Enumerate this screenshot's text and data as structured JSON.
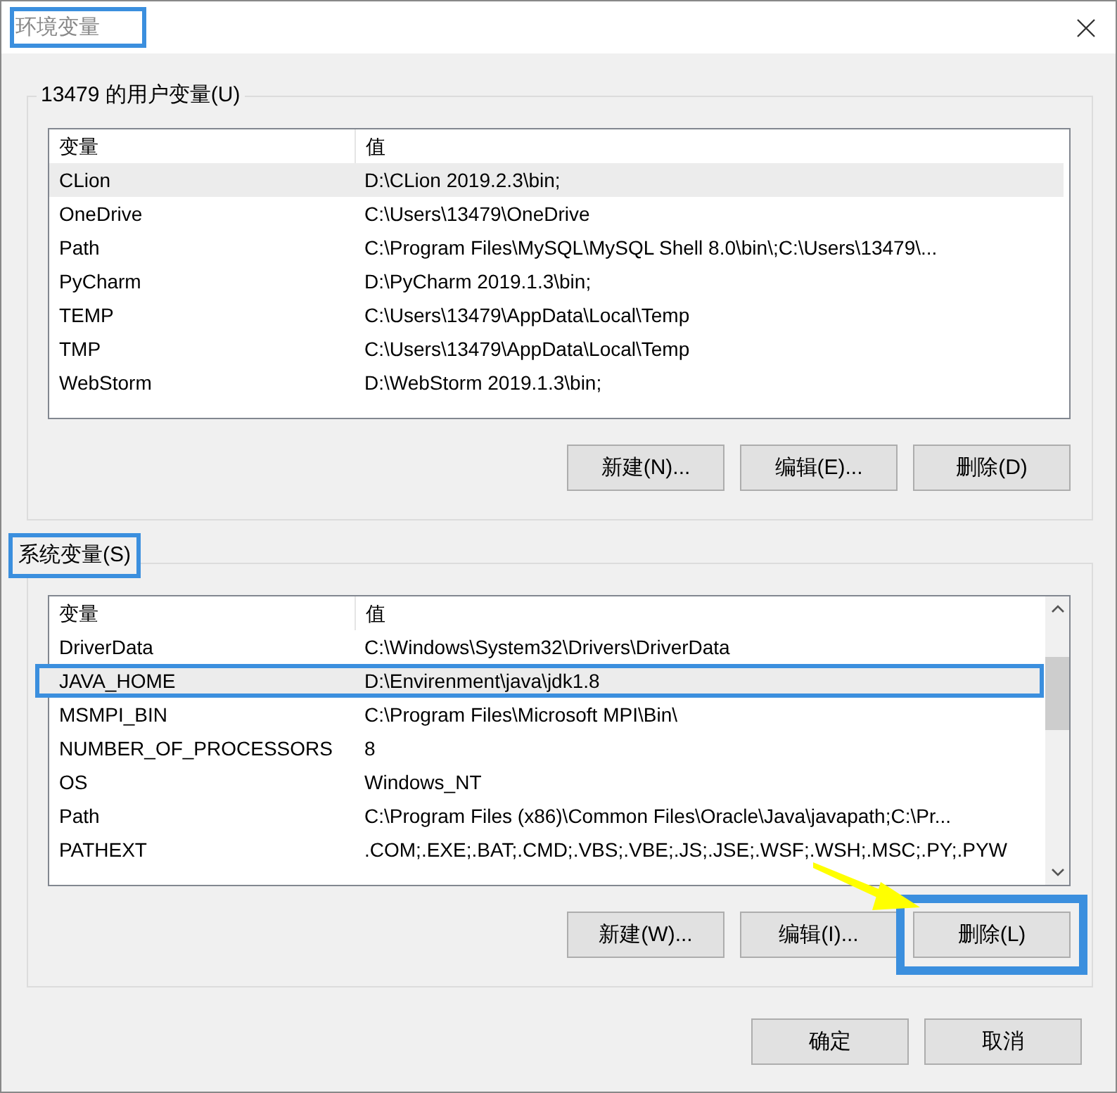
{
  "window": {
    "title": "环境变量",
    "title_highlighted": true
  },
  "user_variables": {
    "label": "13479 的用户变量(U)",
    "columns": [
      "变量",
      "值"
    ],
    "rows": [
      {
        "name": "CLion",
        "value": "D:\\CLion 2019.2.3\\bin;",
        "selected": true,
        "highlighted": false
      },
      {
        "name": "OneDrive",
        "value": "C:\\Users\\13479\\OneDrive",
        "selected": false,
        "highlighted": false
      },
      {
        "name": "Path",
        "value": "C:\\Program Files\\MySQL\\MySQL Shell 8.0\\bin\\;C:\\Users\\13479\\...",
        "selected": false,
        "highlighted": false
      },
      {
        "name": "PyCharm",
        "value": "D:\\PyCharm 2019.1.3\\bin;",
        "selected": false,
        "highlighted": false
      },
      {
        "name": "TEMP",
        "value": "C:\\Users\\13479\\AppData\\Local\\Temp",
        "selected": false,
        "highlighted": false
      },
      {
        "name": "TMP",
        "value": "C:\\Users\\13479\\AppData\\Local\\Temp",
        "selected": false,
        "highlighted": false
      },
      {
        "name": "WebStorm",
        "value": "D:\\WebStorm 2019.1.3\\bin;",
        "selected": false,
        "highlighted": false
      }
    ],
    "buttons": [
      {
        "label": "新建(N)...",
        "highlighted": false
      },
      {
        "label": "编辑(E)...",
        "highlighted": false
      },
      {
        "label": "删除(D)",
        "highlighted": false
      }
    ]
  },
  "system_variables": {
    "label": "系统变量(S)",
    "label_highlighted": true,
    "columns": [
      "变量",
      "值"
    ],
    "rows": [
      {
        "name": "DriverData",
        "value": "C:\\Windows\\System32\\Drivers\\DriverData",
        "selected": false,
        "highlighted": false
      },
      {
        "name": "JAVA_HOME",
        "value": "D:\\Envirenment\\java\\jdk1.8",
        "selected": true,
        "highlighted": true
      },
      {
        "name": "MSMPI_BIN",
        "value": "C:\\Program Files\\Microsoft MPI\\Bin\\",
        "selected": false,
        "highlighted": false
      },
      {
        "name": "NUMBER_OF_PROCESSORS",
        "value": "8",
        "selected": false,
        "highlighted": false
      },
      {
        "name": "OS",
        "value": "Windows_NT",
        "selected": false,
        "highlighted": false
      },
      {
        "name": "Path",
        "value": "C:\\Program Files (x86)\\Common Files\\Oracle\\Java\\javapath;C:\\Pr...",
        "selected": false,
        "highlighted": false
      },
      {
        "name": "PATHEXT",
        "value": ".COM;.EXE;.BAT;.CMD;.VBS;.VBE;.JS;.JSE;.WSF;.WSH;.MSC;.PY;.PYW",
        "selected": false,
        "highlighted": false
      }
    ],
    "scrollbar": true,
    "buttons": [
      {
        "label": "新建(W)...",
        "highlighted": false
      },
      {
        "label": "编辑(I)...",
        "highlighted": false
      },
      {
        "label": "删除(L)",
        "highlighted": true
      }
    ]
  },
  "pointer_arrow": true,
  "dialog_buttons": [
    "确定",
    "取消"
  ]
}
